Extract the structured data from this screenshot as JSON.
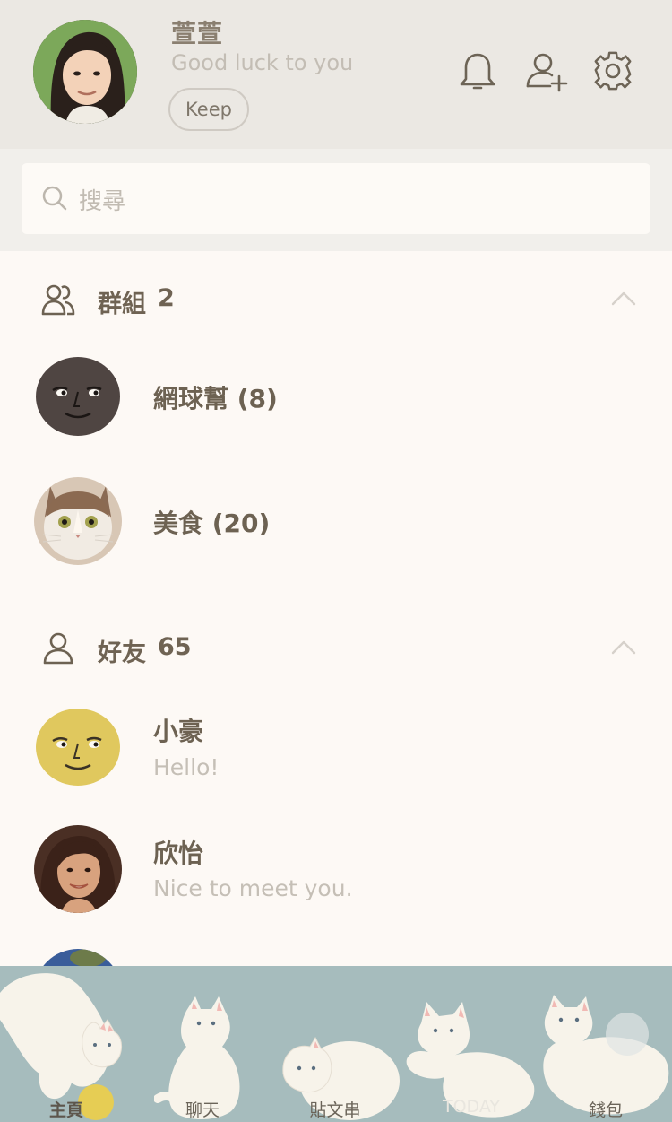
{
  "profile": {
    "name": "萱萱",
    "status": "Good luck to you",
    "keep_label": "Keep"
  },
  "header_icons": [
    "bell-icon",
    "add-friend-icon",
    "gear-icon"
  ],
  "search": {
    "placeholder": "搜尋"
  },
  "groups_section": {
    "label": "群組",
    "count": "2",
    "items": [
      {
        "name": "網球幫 (8)",
        "avatar": "moon-face-dark"
      },
      {
        "name": "美食 (20)",
        "avatar": "cat-photo"
      }
    ]
  },
  "friends_section": {
    "label": "好友",
    "count": "65",
    "items": [
      {
        "name": "小豪",
        "status": "Hello!",
        "avatar": "moon-face-yellow"
      },
      {
        "name": "欣怡",
        "status": "Nice to meet you.",
        "avatar": "woman-photo"
      }
    ]
  },
  "tabs": [
    {
      "label": "主頁",
      "active": true
    },
    {
      "label": "聊天"
    },
    {
      "label": "貼文串"
    },
    {
      "label": "TODAY"
    },
    {
      "label": "錢包"
    }
  ],
  "colors": {
    "header_bg": "#ebe8e3",
    "body_bg": "#fdf9f5",
    "tabbar_bg": "#a6bcbd",
    "text_primary": "#6d6252",
    "text_secondary": "#c5bfb6"
  }
}
